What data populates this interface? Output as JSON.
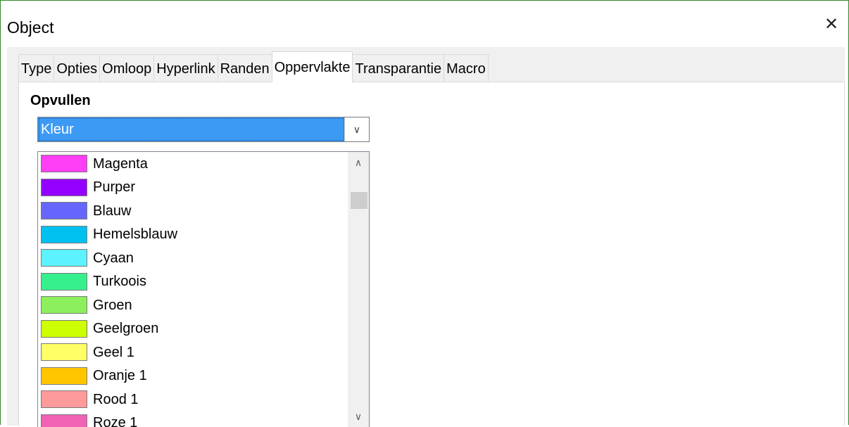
{
  "window": {
    "title": "Object",
    "close_symbol": "✕"
  },
  "tabs": [
    {
      "label": "Type"
    },
    {
      "label": "Opties"
    },
    {
      "label": "Omloop"
    },
    {
      "label": "Hyperlink"
    },
    {
      "label": "Randen"
    },
    {
      "label": "Oppervlakte",
      "active": true
    },
    {
      "label": "Transparantie"
    },
    {
      "label": "Macro"
    }
  ],
  "fill": {
    "section_label": "Opvullen",
    "selected": "Kleur",
    "dropdown_arrow": "∨"
  },
  "colors": [
    {
      "name": "Magenta",
      "hex": "#ff3ff5"
    },
    {
      "name": "Purper",
      "hex": "#9400ff"
    },
    {
      "name": "Blauw",
      "hex": "#6666ff"
    },
    {
      "name": "Hemelsblauw",
      "hex": "#00c0f0"
    },
    {
      "name": "Cyaan",
      "hex": "#5cf2ff"
    },
    {
      "name": "Turkoois",
      "hex": "#35f08c"
    },
    {
      "name": "Groen",
      "hex": "#8cf05c"
    },
    {
      "name": "Geelgroen",
      "hex": "#ccff00"
    },
    {
      "name": "Geel 1",
      "hex": "#ffff66"
    },
    {
      "name": "Oranje 1",
      "hex": "#ffc600"
    },
    {
      "name": "Rood 1",
      "hex": "#ff9a9a"
    },
    {
      "name": "Roze 1",
      "hex": "#f062b4"
    }
  ],
  "scrollbar": {
    "up_symbol": "∧",
    "down_symbol": "∨"
  }
}
